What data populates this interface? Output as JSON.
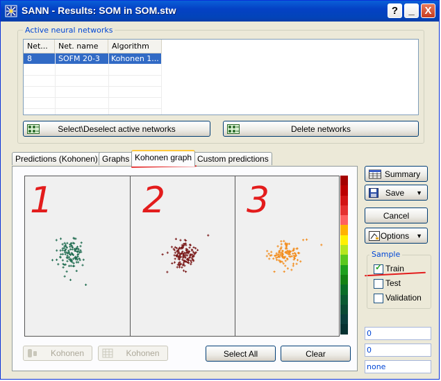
{
  "window": {
    "title": "SANN - Results: SOM in SOM.stw"
  },
  "titlebar_buttons": {
    "help": "?",
    "minimize": "_",
    "close": "X"
  },
  "networks": {
    "group_label": "Active neural networks",
    "columns": [
      "Net...",
      "Net. name",
      "Algorithm"
    ],
    "rows": [
      [
        "8",
        "SOFM 20-3",
        "Kohonen 1..."
      ]
    ]
  },
  "buttons": {
    "select_deselect": "Select\\Deselect active networks",
    "delete": "Delete networks",
    "summary": "Summary",
    "save": "Save",
    "cancel": "Cancel",
    "options": "Options",
    "select_all": "Select All",
    "clear": "Clear",
    "kohonen_1": "Kohonen",
    "kohonen_2": "Kohonen"
  },
  "tabs": [
    {
      "label": "Predictions (Kohonen)",
      "active": false
    },
    {
      "label": "Graphs",
      "active": false
    },
    {
      "label": "Kohonen graph",
      "active": true
    },
    {
      "label": "Custom predictions",
      "active": false
    }
  ],
  "sample": {
    "group_label": "Sample",
    "options": [
      {
        "label": "Train",
        "checked": true
      },
      {
        "label": "Test",
        "checked": false
      },
      {
        "label": "Validation",
        "checked": false
      }
    ]
  },
  "readouts": [
    "0",
    "0",
    "none"
  ],
  "annotations": {
    "digits": [
      "1",
      "2",
      "3"
    ]
  },
  "chart_data": {
    "type": "scatter",
    "panels": [
      {
        "color": "#1e6b4f",
        "center": [
          0.45,
          0.49
        ],
        "spread": [
          0.11,
          0.09
        ],
        "count": 110,
        "outliers": [
          [
            0.58,
            0.68
          ],
          [
            0.3,
            0.4
          ]
        ]
      },
      {
        "color": "#7a1a1a",
        "center": [
          0.51,
          0.49
        ],
        "spread": [
          0.1,
          0.08
        ],
        "count": 140,
        "outliers": [
          [
            0.74,
            0.37
          ],
          [
            0.35,
            0.6
          ]
        ]
      },
      {
        "color": "#f28c1c",
        "center": [
          0.48,
          0.49
        ],
        "spread": [
          0.12,
          0.07
        ],
        "count": 110,
        "outliers": [
          [
            0.82,
            0.43
          ],
          [
            0.3,
            0.5
          ]
        ]
      }
    ],
    "colorscale": [
      "#a40000",
      "#bc0000",
      "#d21414",
      "#e43030",
      "#ff6060",
      "#ffb200",
      "#fff000",
      "#b4e61e",
      "#5ac81e",
      "#1ea01e",
      "#148214",
      "#0a6e28",
      "#0a5a32",
      "#0a4a34",
      "#0a3e3c",
      "#063232"
    ]
  },
  "colors": {
    "accent": "#0046d5",
    "annotation": "#e31c1c",
    "selection": "#316ac5"
  }
}
